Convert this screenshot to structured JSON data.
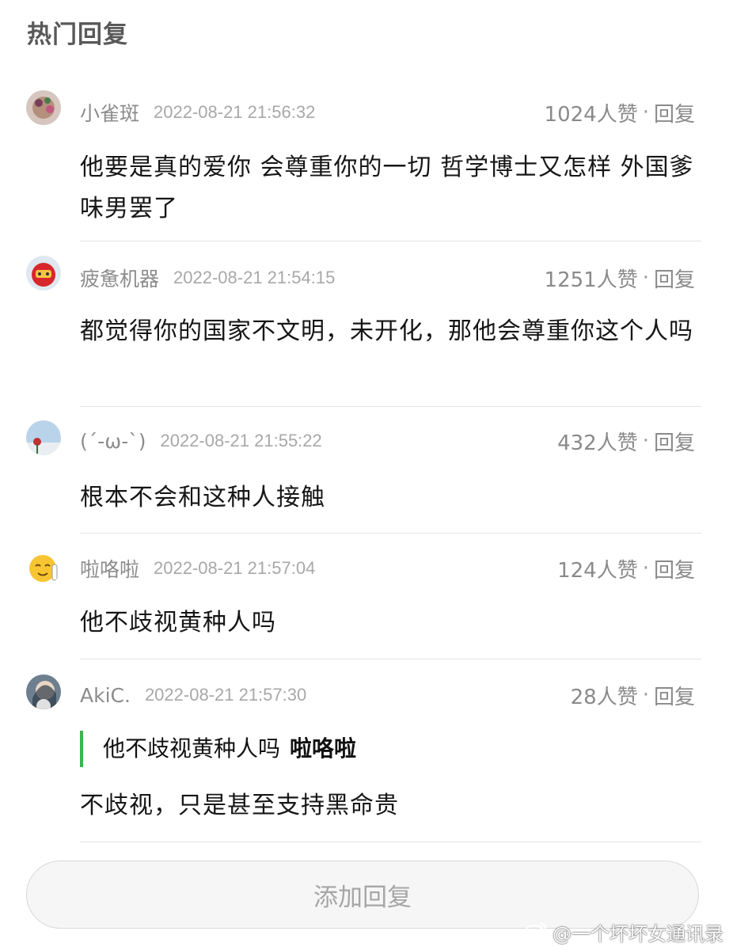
{
  "section_title": "热门回复",
  "comments": [
    {
      "username": "小雀斑",
      "timestamp": "2022-08-21 21:56:32",
      "likes": "1024人赞",
      "separator": "·",
      "reply_label": "回复",
      "text": "他要是真的爱你 会尊重你的一切 哲学博士又怎样 外国爹味男罢了"
    },
    {
      "username": "疲惫机器",
      "timestamp": "2022-08-21 21:54:15",
      "likes": "1251人赞",
      "separator": "·",
      "reply_label": "回复",
      "text": "都觉得你的国家不文明，未开化，那他会尊重你这个人吗"
    },
    {
      "username": "(´-ω-`)",
      "timestamp": "2022-08-21 21:55:22",
      "likes": "432人赞",
      "separator": "·",
      "reply_label": "回复",
      "text": "根本不会和这种人接触"
    },
    {
      "username": "啦咯啦",
      "timestamp": "2022-08-21 21:57:04",
      "likes": "124人赞",
      "separator": "·",
      "reply_label": "回复",
      "text": "他不歧视黄种人吗"
    },
    {
      "username": "AkiC.",
      "timestamp": "2022-08-21 21:57:30",
      "likes": "28人赞",
      "separator": "·",
      "reply_label": "回复",
      "quote": {
        "text": "他不歧视黄种人吗",
        "author": "啦咯啦"
      },
      "text": "不歧视，只是甚至支持黑命贵"
    }
  ],
  "add_reply_label": "添加回复",
  "watermark": {
    "icon": "weibo-icon",
    "text": "@一个坏坏女通讯录"
  },
  "colors": {
    "quote_bar": "#3cb44b",
    "meta_text": "#8c8c8c",
    "divider": "#e3e3e3"
  }
}
